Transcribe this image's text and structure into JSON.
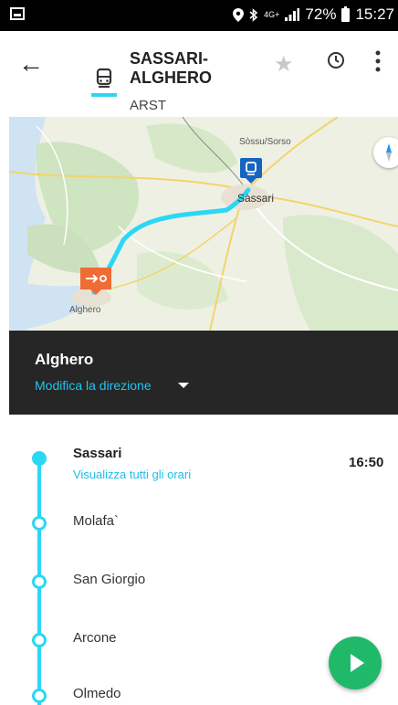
{
  "status_bar": {
    "network": "4G+",
    "battery": "72%",
    "time": "15:27"
  },
  "route": {
    "title": "SASSARI-ALGHERO",
    "operator": "ARST",
    "accent_color": "#2cd7f4"
  },
  "map": {
    "labels": {
      "sorso": "Sòssu/Sorso",
      "sassari": "Sàssari",
      "alghero": "Alghero"
    },
    "origin_marker": "train-icon",
    "destination_marker": "arrow-right-icon"
  },
  "direction": {
    "destination": "Alghero",
    "change_label": "Modifica la direzione"
  },
  "stops": {
    "first": {
      "name": "Sassari",
      "link": "Visualizza tutti gli orari",
      "time": "16:50"
    },
    "list": [
      {
        "name": "Molafa`"
      },
      {
        "name": "San Giorgio"
      },
      {
        "name": "Arcone"
      },
      {
        "name": "Olmedo"
      }
    ]
  },
  "colors": {
    "fab": "#20b96a",
    "dark_panel": "#262626",
    "link": "#1fc6ef"
  }
}
